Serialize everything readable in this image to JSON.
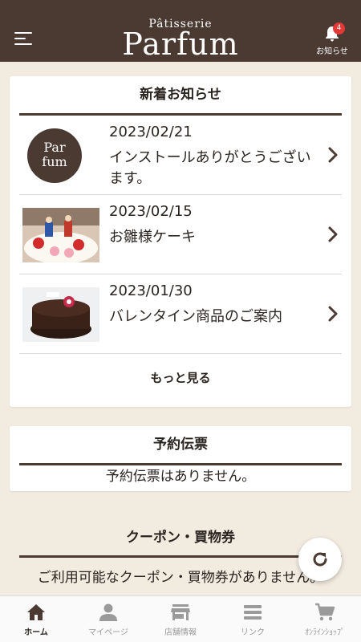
{
  "header": {
    "brand_sub": "Pâtisserie",
    "brand_main": "Parfum",
    "notification_count": "4",
    "notification_label": "お知らせ"
  },
  "news": {
    "title": "新着お知らせ",
    "items": [
      {
        "date": "2023/02/21",
        "text": "インストールありがとうございます。",
        "thumb_icon": "parfum-logo-icon"
      },
      {
        "date": "2023/02/15",
        "text": "お雛様ケーキ",
        "thumb_icon": "hina-cake-photo"
      },
      {
        "date": "2023/01/30",
        "text": "バレンタイン商品のご案内",
        "thumb_icon": "chocolate-cake-photo"
      }
    ],
    "more_label": "もっと見る"
  },
  "reservation": {
    "title": "予約伝票",
    "empty_text": "予約伝票はありません。"
  },
  "coupon": {
    "title": "クーポン・買物券",
    "empty_text": "ご利用可能なクーポン・買物券がありません。"
  },
  "tabs": [
    {
      "label": "ホーム",
      "icon": "home-icon",
      "active": true
    },
    {
      "label": "マイページ",
      "icon": "person-icon",
      "active": false
    },
    {
      "label": "店舗情報",
      "icon": "store-icon",
      "active": false
    },
    {
      "label": "リンク",
      "icon": "list-icon",
      "active": false
    },
    {
      "label": "ｵﾝﾗｲﾝｼｮｯﾌﾟ",
      "icon": "cart-icon",
      "active": false
    }
  ],
  "colors": {
    "brand_brown": "#4a3a32",
    "background": "#f2ebe0",
    "badge_red": "#e53935"
  }
}
